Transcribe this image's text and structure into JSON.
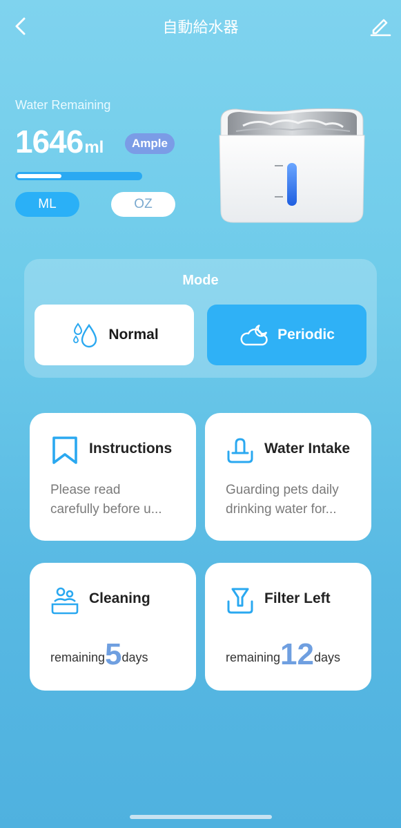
{
  "header": {
    "title": "自動給水器"
  },
  "water": {
    "label": "Water Remaining",
    "value": "1646",
    "unit": "ml",
    "status": "Ample",
    "level_fraction": 0.36
  },
  "units": {
    "ml": "ML",
    "oz": "OZ",
    "selected": "ML"
  },
  "mode": {
    "title": "Mode",
    "options": [
      {
        "label": "Normal",
        "icon": "water-drops-icon",
        "selected": false
      },
      {
        "label": "Periodic",
        "icon": "cloud-moon-icon",
        "selected": true
      }
    ]
  },
  "cards": {
    "instructions": {
      "title": "Instructions",
      "desc_line1": "Please read",
      "desc_line2": "carefully before u...",
      "icon": "bookmark-icon"
    },
    "water_intake": {
      "title": "Water Intake",
      "desc_line1": "Guarding pets daily",
      "desc_line2": "drinking water for...",
      "icon": "water-bowl-icon"
    },
    "cleaning": {
      "title": "Cleaning",
      "prefix": "remaining",
      "value": "5",
      "suffix": "days",
      "icon": "cleaning-icon"
    },
    "filter": {
      "title": "Filter Left",
      "prefix": "remaining",
      "value": "12",
      "suffix": "days",
      "icon": "filter-icon"
    }
  },
  "colors": {
    "accent": "#2fb1f6",
    "badge": "#7b9ce6",
    "icon_blue": "#2aa8f0",
    "remain_number": "#6f9fe0"
  }
}
